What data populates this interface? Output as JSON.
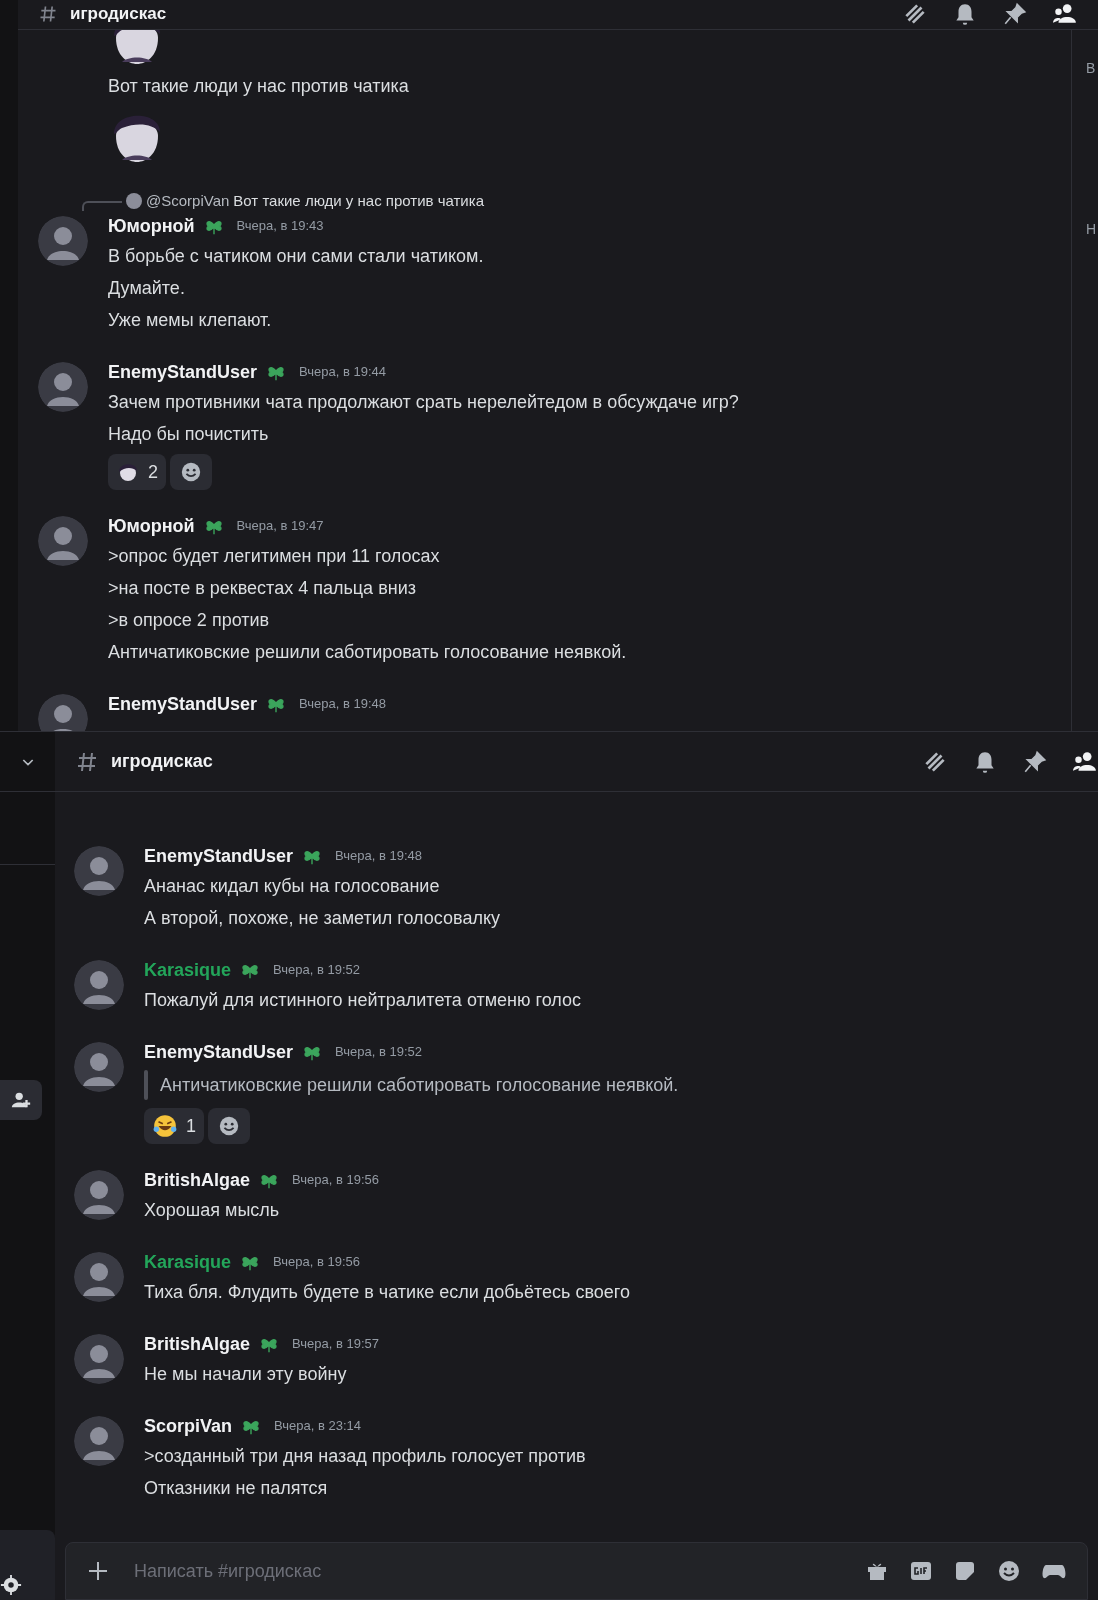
{
  "panels": [
    {
      "header": {
        "title": "игродискас"
      },
      "side_letters": [
        "В",
        "Н"
      ],
      "messages": [
        {
          "kind": "continuation",
          "blocks": [
            {
              "kind": "sticker"
            },
            {
              "kind": "text",
              "text": "Вот такие люди у нас против чатика"
            },
            {
              "kind": "sticker"
            }
          ]
        },
        {
          "kind": "message",
          "reply": {
            "author": "@ScorpiVan",
            "text": "Вот такие люди у нас против чатика"
          },
          "author": "Юморной",
          "color": "#f2f3f5",
          "time": "Вчера, в 19:43",
          "blocks": [
            {
              "kind": "text",
              "text": "В борьбе с чатиком они сами стали чатиком."
            },
            {
              "kind": "text",
              "text": "Думайте."
            },
            {
              "kind": "text",
              "text": "Уже мемы клепают."
            }
          ]
        },
        {
          "kind": "message",
          "author": "EnemyStandUser",
          "color": "#f2f3f5",
          "time": "Вчера, в 19:44",
          "blocks": [
            {
              "kind": "text",
              "text": "Зачем противники чата продолжают срать нерелейтедом в обсуждаче игр?"
            },
            {
              "kind": "text",
              "text": "Надо бы почистить"
            }
          ],
          "reactions": [
            {
              "kind": "custom",
              "count": "2"
            },
            {
              "kind": "add"
            }
          ]
        },
        {
          "kind": "message",
          "author": "Юморной",
          "color": "#f2f3f5",
          "time": "Вчера, в 19:47",
          "blocks": [
            {
              "kind": "text",
              "text": ">опрос будет легитимен при 11 голосах"
            },
            {
              "kind": "text",
              "text": ">на посте в реквестах 4 пальца вниз"
            },
            {
              "kind": "text",
              "text": ">в опросе 2 против"
            },
            {
              "kind": "text",
              "text": "Античатиковские решили саботировать голосование неявкой."
            }
          ]
        },
        {
          "kind": "message",
          "author": "EnemyStandUser",
          "color": "#f2f3f5",
          "time": "Вчера, в 19:48"
        }
      ]
    },
    {
      "header": {
        "title": "игродискас"
      },
      "composer": {
        "placeholder": "Написать #игродискас"
      },
      "messages": [
        {
          "kind": "message",
          "author": "EnemyStandUser",
          "color": "#f2f3f5",
          "time": "Вчера, в 19:48",
          "blocks": [
            {
              "kind": "text",
              "text": "Ананас кидал кубы на голосование"
            },
            {
              "kind": "text",
              "text": "А второй, похоже, не заметил голосовалку"
            }
          ]
        },
        {
          "kind": "message",
          "author": "Karasique",
          "color": "#23a55a",
          "time": "Вчера, в 19:52",
          "blocks": [
            {
              "kind": "text",
              "text": "Пожалуй для истинного нейтралитета отменю голос"
            }
          ]
        },
        {
          "kind": "message",
          "author": "EnemyStandUser",
          "color": "#f2f3f5",
          "time": "Вчера, в 19:52",
          "blocks": [
            {
              "kind": "quote",
              "text": "Античатиковские решили саботировать голосование неявкой."
            }
          ],
          "reactions": [
            {
              "kind": "laughing",
              "count": "1"
            },
            {
              "kind": "add"
            }
          ]
        },
        {
          "kind": "message",
          "author": "BritishAlgae",
          "color": "#f2f3f5",
          "time": "Вчера, в 19:56",
          "blocks": [
            {
              "kind": "text",
              "text": "Хорошая мысль"
            }
          ]
        },
        {
          "kind": "message",
          "author": "Karasique",
          "color": "#23a55a",
          "time": "Вчера, в 19:56",
          "blocks": [
            {
              "kind": "text",
              "text": "Тиха бля. Флудить будете в чатике если добьётесь своего"
            }
          ]
        },
        {
          "kind": "message",
          "author": "BritishAlgae",
          "color": "#f2f3f5",
          "time": "Вчера, в 19:57",
          "blocks": [
            {
              "kind": "text",
              "text": "Не мы начали эту войну"
            }
          ]
        },
        {
          "kind": "message",
          "author": "ScorpiVan",
          "color": "#f2f3f5",
          "time": "Вчера, в 23:14",
          "blocks": [
            {
              "kind": "text",
              "text": ">созданный три дня назад профиль голосует против"
            },
            {
              "kind": "text",
              "text": "Отказники не палятся"
            }
          ]
        }
      ]
    }
  ]
}
